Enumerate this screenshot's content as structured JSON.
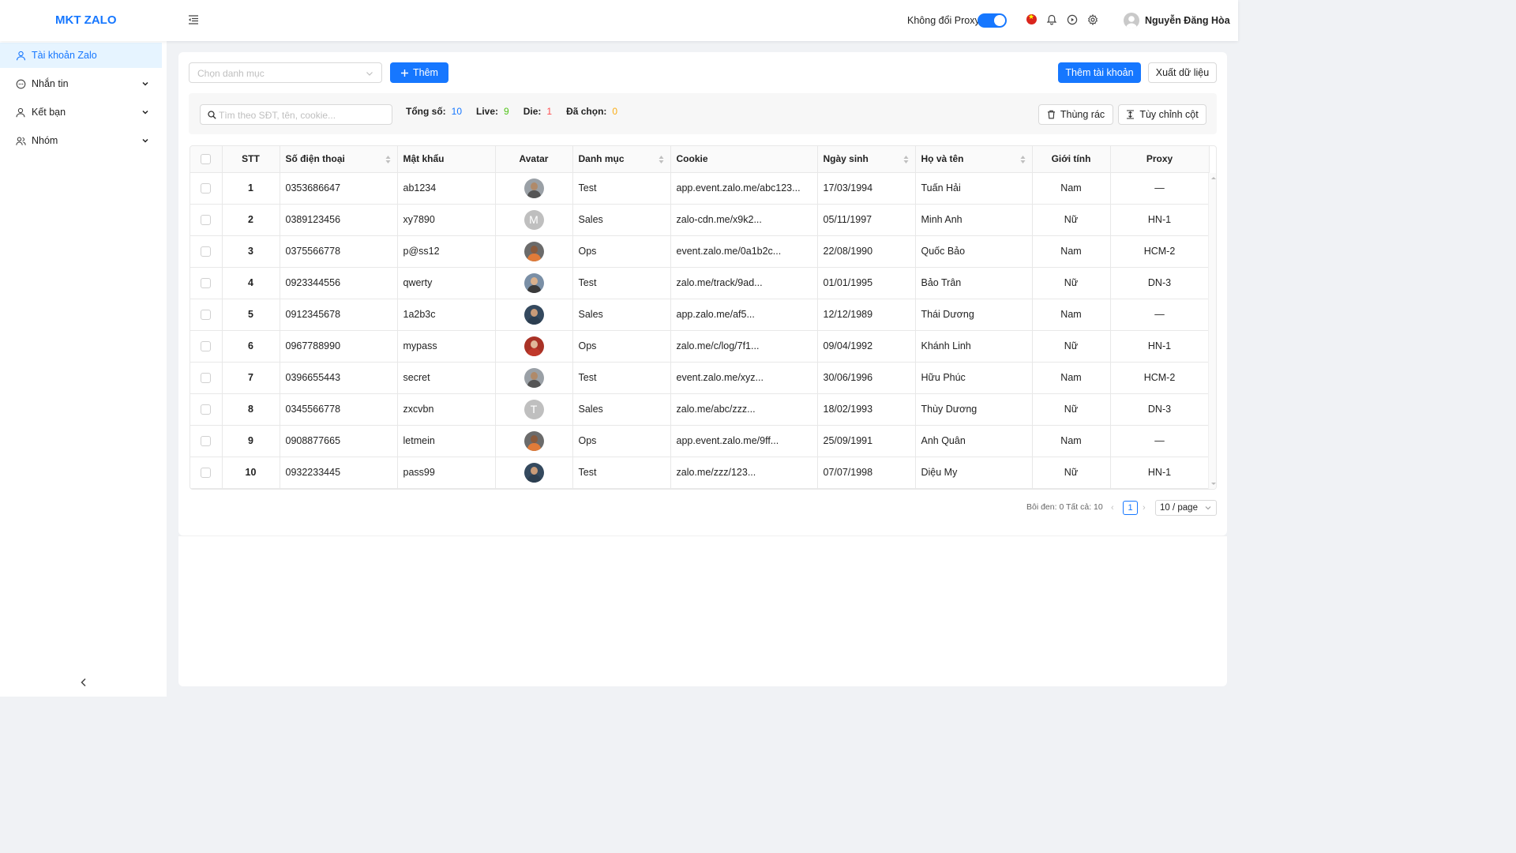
{
  "header": {
    "logo": "MKT ZALO",
    "proxy_label": "Không đổi Proxy",
    "user_name": "Nguyễn Đăng Hòa"
  },
  "sidebar": {
    "items": [
      {
        "label": "Tài khoản Zalo",
        "icon": "user-icon",
        "active": true
      },
      {
        "label": "Nhắn tin",
        "icon": "chat-icon"
      },
      {
        "label": "Kết bạn",
        "icon": "user-add-icon"
      },
      {
        "label": "Nhóm",
        "icon": "group-icon"
      }
    ]
  },
  "toolbar": {
    "category_placeholder": "Chọn danh mục",
    "add_label": "Thêm",
    "add_account_label": "Thêm tài khoản",
    "export_label": "Xuất dữ liệu"
  },
  "filter": {
    "search_placeholder": "Tìm theo SĐT, tên, cookie...",
    "total_label": "Tổng số:",
    "total_value": "10",
    "live_label": "Live:",
    "live_value": "9",
    "die_label": "Die:",
    "die_value": "1",
    "selected_label": "Đã chọn:",
    "selected_value": "0",
    "trash_label": "Thùng rác",
    "columns_label": "Tùy chỉnh cột"
  },
  "colors": {
    "primary": "#1677ff",
    "live": "#52c41a",
    "die": "#ff4d4f",
    "selected": "#faad14"
  },
  "table": {
    "headers": {
      "stt": "STT",
      "phone": "Số điện thoại",
      "password": "Mật khẩu",
      "avatar": "Avatar",
      "category": "Danh mục",
      "cookie": "Cookie",
      "birthday": "Ngày sinh",
      "name": "Họ và tên",
      "gender": "Giới tính",
      "proxy": "Proxy"
    },
    "rows": [
      {
        "stt": "1",
        "phone": "0353686647",
        "password": "ab1234",
        "avatar": {
          "type": "photo",
          "skin": "#b08a6a",
          "shirt": "#555555",
          "bg": "#9aa0a6"
        },
        "category": "Test",
        "cookie": "app.event.zalo.me/abc123...",
        "birthday": "17/03/1994",
        "name": "Tuấn Hải",
        "gender": "Nam",
        "proxy": "—"
      },
      {
        "stt": "2",
        "phone": "0389123456",
        "password": "xy7890",
        "avatar": {
          "type": "letter",
          "letter": "M"
        },
        "category": "Sales",
        "cookie": "zalo-cdn.me/x9k2...",
        "birthday": "05/11/1997",
        "name": "Minh Anh",
        "gender": "Nữ",
        "proxy": "HN-1"
      },
      {
        "stt": "3",
        "phone": "0375566778",
        "password": "p@ss12",
        "avatar": {
          "type": "photo",
          "skin": "#8a5a3c",
          "shirt": "#e07b39",
          "bg": "#6b6b6b"
        },
        "category": "Ops",
        "cookie": "event.zalo.me/0a1b2c...",
        "birthday": "22/08/1990",
        "name": "Quốc Bảo",
        "gender": "Nam",
        "proxy": "HCM-2"
      },
      {
        "stt": "4",
        "phone": "0923344556",
        "password": "qwerty",
        "avatar": {
          "type": "photo",
          "skin": "#d9b08c",
          "shirt": "#3a3a3a",
          "bg": "#7a8fa6"
        },
        "category": "Test",
        "cookie": "zalo.me/track/9ad...",
        "birthday": "01/01/1995",
        "name": "Bảo Trân",
        "gender": "Nữ",
        "proxy": "DN-3"
      },
      {
        "stt": "5",
        "phone": "0912345678",
        "password": "1a2b3c",
        "avatar": {
          "type": "photo",
          "skin": "#c99b78",
          "shirt": "#2c3e50",
          "bg": "#34495e"
        },
        "category": "Sales",
        "cookie": "app.zalo.me/af5...",
        "birthday": "12/12/1989",
        "name": "Thái Dương",
        "gender": "Nam",
        "proxy": "—"
      },
      {
        "stt": "6",
        "phone": "0967788990",
        "password": "mypass",
        "avatar": {
          "type": "photo",
          "skin": "#e0b89a",
          "shirt": "#c0392b",
          "bg": "#a93226"
        },
        "category": "Ops",
        "cookie": "zalo.me/c/log/7f1...",
        "birthday": "09/04/1992",
        "name": "Khánh Linh",
        "gender": "Nữ",
        "proxy": "HN-1"
      },
      {
        "stt": "7",
        "phone": "0396655443",
        "password": "secret",
        "avatar": {
          "type": "photo",
          "skin": "#b08a6a",
          "shirt": "#555555",
          "bg": "#9aa0a6"
        },
        "category": "Test",
        "cookie": "event.zalo.me/xyz...",
        "birthday": "30/06/1996",
        "name": "Hữu Phúc",
        "gender": "Nam",
        "proxy": "HCM-2"
      },
      {
        "stt": "8",
        "phone": "0345566778",
        "password": "zxcvbn",
        "avatar": {
          "type": "letter",
          "letter": "T"
        },
        "category": "Sales",
        "cookie": "zalo.me/abc/zzz...",
        "birthday": "18/02/1993",
        "name": "Thùy Dương",
        "gender": "Nữ",
        "proxy": "DN-3"
      },
      {
        "stt": "9",
        "phone": "0908877665",
        "password": "letmein",
        "avatar": {
          "type": "photo",
          "skin": "#8a5a3c",
          "shirt": "#e07b39",
          "bg": "#6b6b6b"
        },
        "category": "Ops",
        "cookie": "app.event.zalo.me/9ff...",
        "birthday": "25/09/1991",
        "name": "Anh Quân",
        "gender": "Nam",
        "proxy": "—"
      },
      {
        "stt": "10",
        "phone": "0932233445",
        "password": "pass99",
        "avatar": {
          "type": "photo",
          "skin": "#c99b78",
          "shirt": "#2c3e50",
          "bg": "#34495e"
        },
        "category": "Test",
        "cookie": "zalo.me/zzz/123...",
        "birthday": "07/07/1998",
        "name": "Diệu My",
        "gender": "Nữ",
        "proxy": "HN-1"
      }
    ]
  },
  "pagination": {
    "info": "Bôi đen: 0 Tất cả: 10",
    "current_page": "1",
    "page_size": "10 / page"
  }
}
